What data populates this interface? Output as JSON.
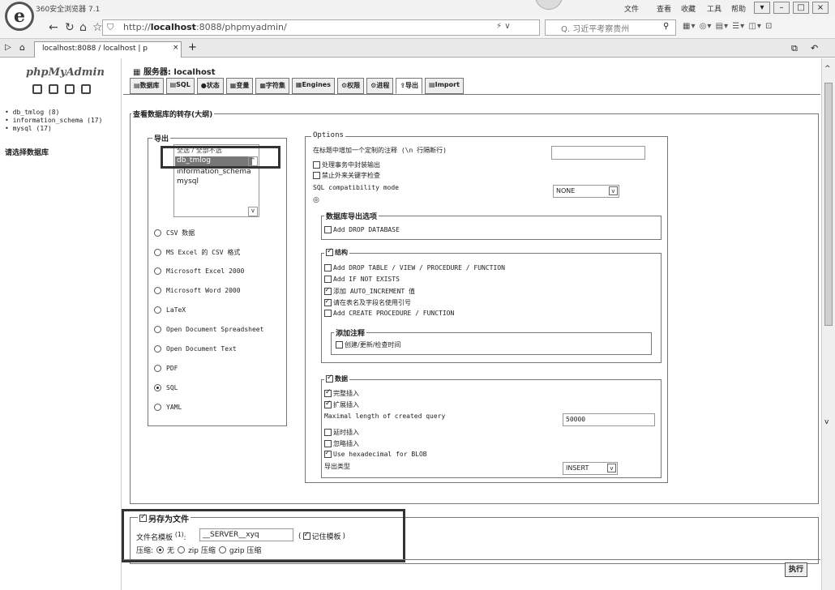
{
  "browser": {
    "title": "360安全浏览器 7.1",
    "menu": [
      "文件",
      "查看",
      "收藏",
      "工具",
      "帮助"
    ],
    "address_host": "localhost",
    "address_prefix": "http://",
    "address_rest": ":8088/phpmyadmin/",
    "search_placeholder": "Q. 习近平考察贵州",
    "tab_label": "localhost:8088 / localhost | p",
    "tab_close": "×",
    "new_tab": "+"
  },
  "pma": {
    "logo": "phpMyAdmin",
    "databases": [
      {
        "label": "db_tmlog (8)"
      },
      {
        "label": "information_schema (17)"
      },
      {
        "label": "mysql (17)"
      }
    ],
    "choose_db": "请选择数据库",
    "server_label": "服务器: localhost",
    "tabs": [
      "数据库",
      "SQL",
      "状态",
      "变量",
      "字符集",
      "Engines",
      "权限",
      "进程",
      "导出",
      "Import"
    ],
    "active_tab": "导出"
  },
  "export": {
    "main_legend": "查看数据库的转存(大纲)",
    "export_legend": "导出",
    "select_header": "全选 / 全部不选",
    "db_options": [
      "db_tmlog",
      "information_schema",
      "mysql"
    ],
    "formats": [
      "CSV 数据",
      "MS Excel 的 CSV 格式",
      "Microsoft Excel 2000",
      "Microsoft Word 2000",
      "LaTeX",
      "Open Document Spreadsheet",
      "Open Document Text",
      "PDF",
      "SQL",
      "YAML"
    ],
    "selected_format": "SQL"
  },
  "options": {
    "legend": "Options",
    "comment_label": "在标题中增加一个定制的注释 (\\n 行隔断行)",
    "comment_value": "",
    "transaction": "处理事务中封装输出",
    "disable_fk": "禁止外来关键字检查",
    "compat_label": "SQL compatibility mode",
    "compat_value": "NONE",
    "db_export_legend": "数据库导出选项",
    "add_drop_db": "Add DROP DATABASE",
    "structure_legend": "结构",
    "structure_items": [
      {
        "label": "Add DROP TABLE / VIEW / PROCEDURE / FUNCTION",
        "checked": false
      },
      {
        "label": "Add IF NOT EXISTS",
        "checked": false
      },
      {
        "label": "添加 AUTO_INCREMENT 值",
        "checked": true
      },
      {
        "label": "请在表名及字段名使用引号",
        "checked": true
      },
      {
        "label": "Add CREATE PROCEDURE / FUNCTION",
        "checked": false
      }
    ],
    "comments_legend": "添加注释",
    "comments_item": "创建/更新/检查时间",
    "data_legend": "数据",
    "data_items": [
      {
        "label": "完整插入",
        "checked": true
      },
      {
        "label": "扩展插入",
        "checked": true
      }
    ],
    "max_query_label": "Maximal length of created query",
    "max_query_value": "50000",
    "data_items2": [
      {
        "label": "延时插入",
        "checked": false
      },
      {
        "label": "忽略插入",
        "checked": false
      },
      {
        "label": "Use hexadecimal for BLOB",
        "checked": true
      }
    ],
    "export_type_label": "导出类型",
    "export_type_value": "INSERT"
  },
  "save": {
    "legend": "另存为文件",
    "template_label": "文件名模板",
    "template_sup": "(1)",
    "template_value": "__SERVER__xyq",
    "remember_label": "记住模板",
    "compression_label": "压缩:",
    "compression_options": [
      "无",
      "zip 压缩",
      "gzip 压缩"
    ],
    "compression_selected": "无",
    "go": "执行"
  }
}
